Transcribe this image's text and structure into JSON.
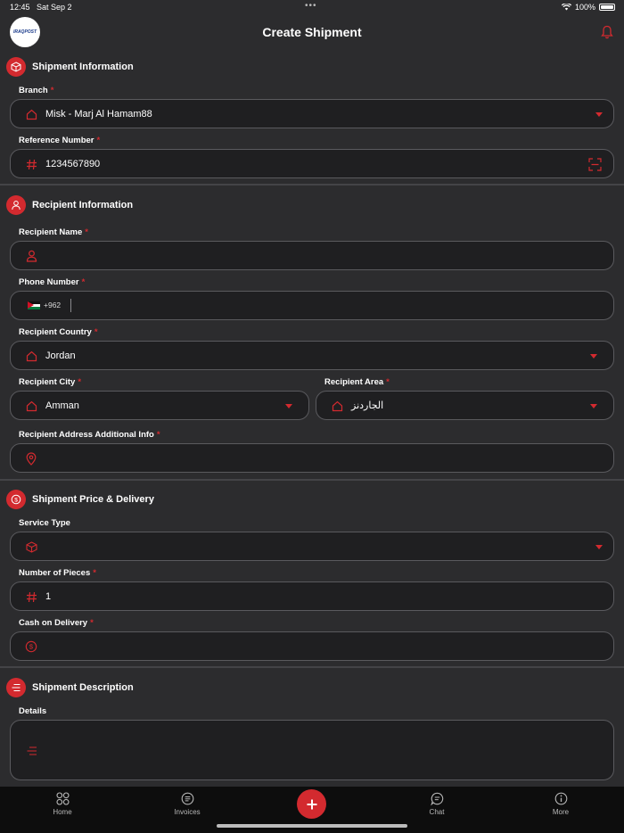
{
  "status": {
    "time": "12:45",
    "date": "Sat Sep 2",
    "battery": "100%"
  },
  "header": {
    "title": "Create Shipment",
    "logo_text": "IRAQPOST"
  },
  "shipment_info": {
    "title": "Shipment Information",
    "branch_label": "Branch",
    "branch_value": "Misk - Marj Al Hamam88",
    "reference_label": "Reference Number",
    "reference_value": "1234567890"
  },
  "recipient_info": {
    "title": "Recipient Information",
    "name_label": "Recipient Name",
    "name_value": "",
    "phone_label": "Phone Number",
    "phone_code": "+962",
    "phone_value": "",
    "country_label": "Recipient Country",
    "country_value": "Jordan",
    "city_label": "Recipient City",
    "city_value": "Amman",
    "area_label": "Recipient Area",
    "area_value": "الجاردنز",
    "address_label": "Recipient Address Additional Info",
    "address_value": ""
  },
  "price_delivery": {
    "title": "Shipment Price & Delivery",
    "service_label": "Service Type",
    "service_value": "",
    "pieces_label": "Number of Pieces",
    "pieces_value": "1",
    "cod_label": "Cash on Delivery",
    "cod_value": ""
  },
  "description": {
    "title": "Shipment Description",
    "details_label": "Details",
    "details_value": ""
  },
  "required_mark": "*",
  "tabs": [
    {
      "label": "Home",
      "icon": "grid-icon"
    },
    {
      "label": "Invoices",
      "icon": "invoice-icon"
    },
    {
      "label": "",
      "icon": "plus-icon"
    },
    {
      "label": "Chat",
      "icon": "chat-icon"
    },
    {
      "label": "More",
      "icon": "info-icon"
    }
  ],
  "colors": {
    "accent": "#d32a2f",
    "background": "#2c2c2e",
    "field": "#1f1f21",
    "tabbar": "#0d0d0d"
  }
}
